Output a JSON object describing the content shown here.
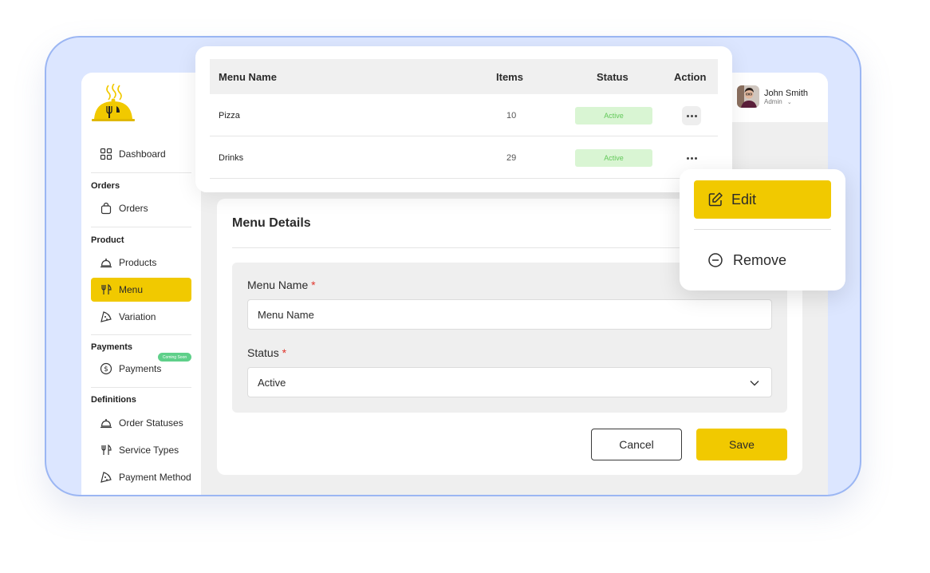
{
  "colors": {
    "accent": "#f1c900",
    "frame": "#dce6ff",
    "status_active_bg": "#d9f5d3",
    "status_active_text": "#63c95a",
    "required": "#e0342b",
    "coming_soon": "#5fd08a"
  },
  "sidebar": {
    "logo_icon": "chef-cloche-icon",
    "dashboard": {
      "label": "Dashboard",
      "icon": "grid-icon"
    },
    "sections": [
      {
        "title": "Orders",
        "items": [
          {
            "label": "Orders",
            "icon": "bag-icon"
          }
        ]
      },
      {
        "title": "Product",
        "items": [
          {
            "label": "Products",
            "icon": "cloche-icon"
          },
          {
            "label": "Menu",
            "icon": "fork-knife-icon"
          },
          {
            "label": "Variation",
            "icon": "pizza-icon"
          }
        ]
      },
      {
        "title": "Payments",
        "badge": "Coming Soon",
        "items": [
          {
            "label": "Payments",
            "icon": "dollar-icon"
          }
        ]
      },
      {
        "title": "Definitions",
        "items": [
          {
            "label": "Order Statuses",
            "icon": "cloche-icon"
          },
          {
            "label": "Service Types",
            "icon": "fork-knife-icon"
          },
          {
            "label": "Payment Method",
            "icon": "pizza-icon"
          }
        ]
      }
    ]
  },
  "header": {
    "user_name": "John Smith",
    "user_role": "Admin"
  },
  "table": {
    "headers": {
      "name": "Menu Name",
      "items": "Items",
      "status": "Status",
      "action": "Action"
    },
    "rows": [
      {
        "name": "Pizza",
        "items": "10",
        "status": "Active"
      },
      {
        "name": "Drinks",
        "items": "29",
        "status": "Active"
      }
    ]
  },
  "action_menu": {
    "edit": "Edit",
    "remove": "Remove"
  },
  "details": {
    "title": "Menu Details",
    "menu_name_label": "Menu Name",
    "menu_name_value": "Menu Name",
    "status_label": "Status",
    "status_value": "Active",
    "required_mark": "*",
    "cancel": "Cancel",
    "save": "Save"
  }
}
